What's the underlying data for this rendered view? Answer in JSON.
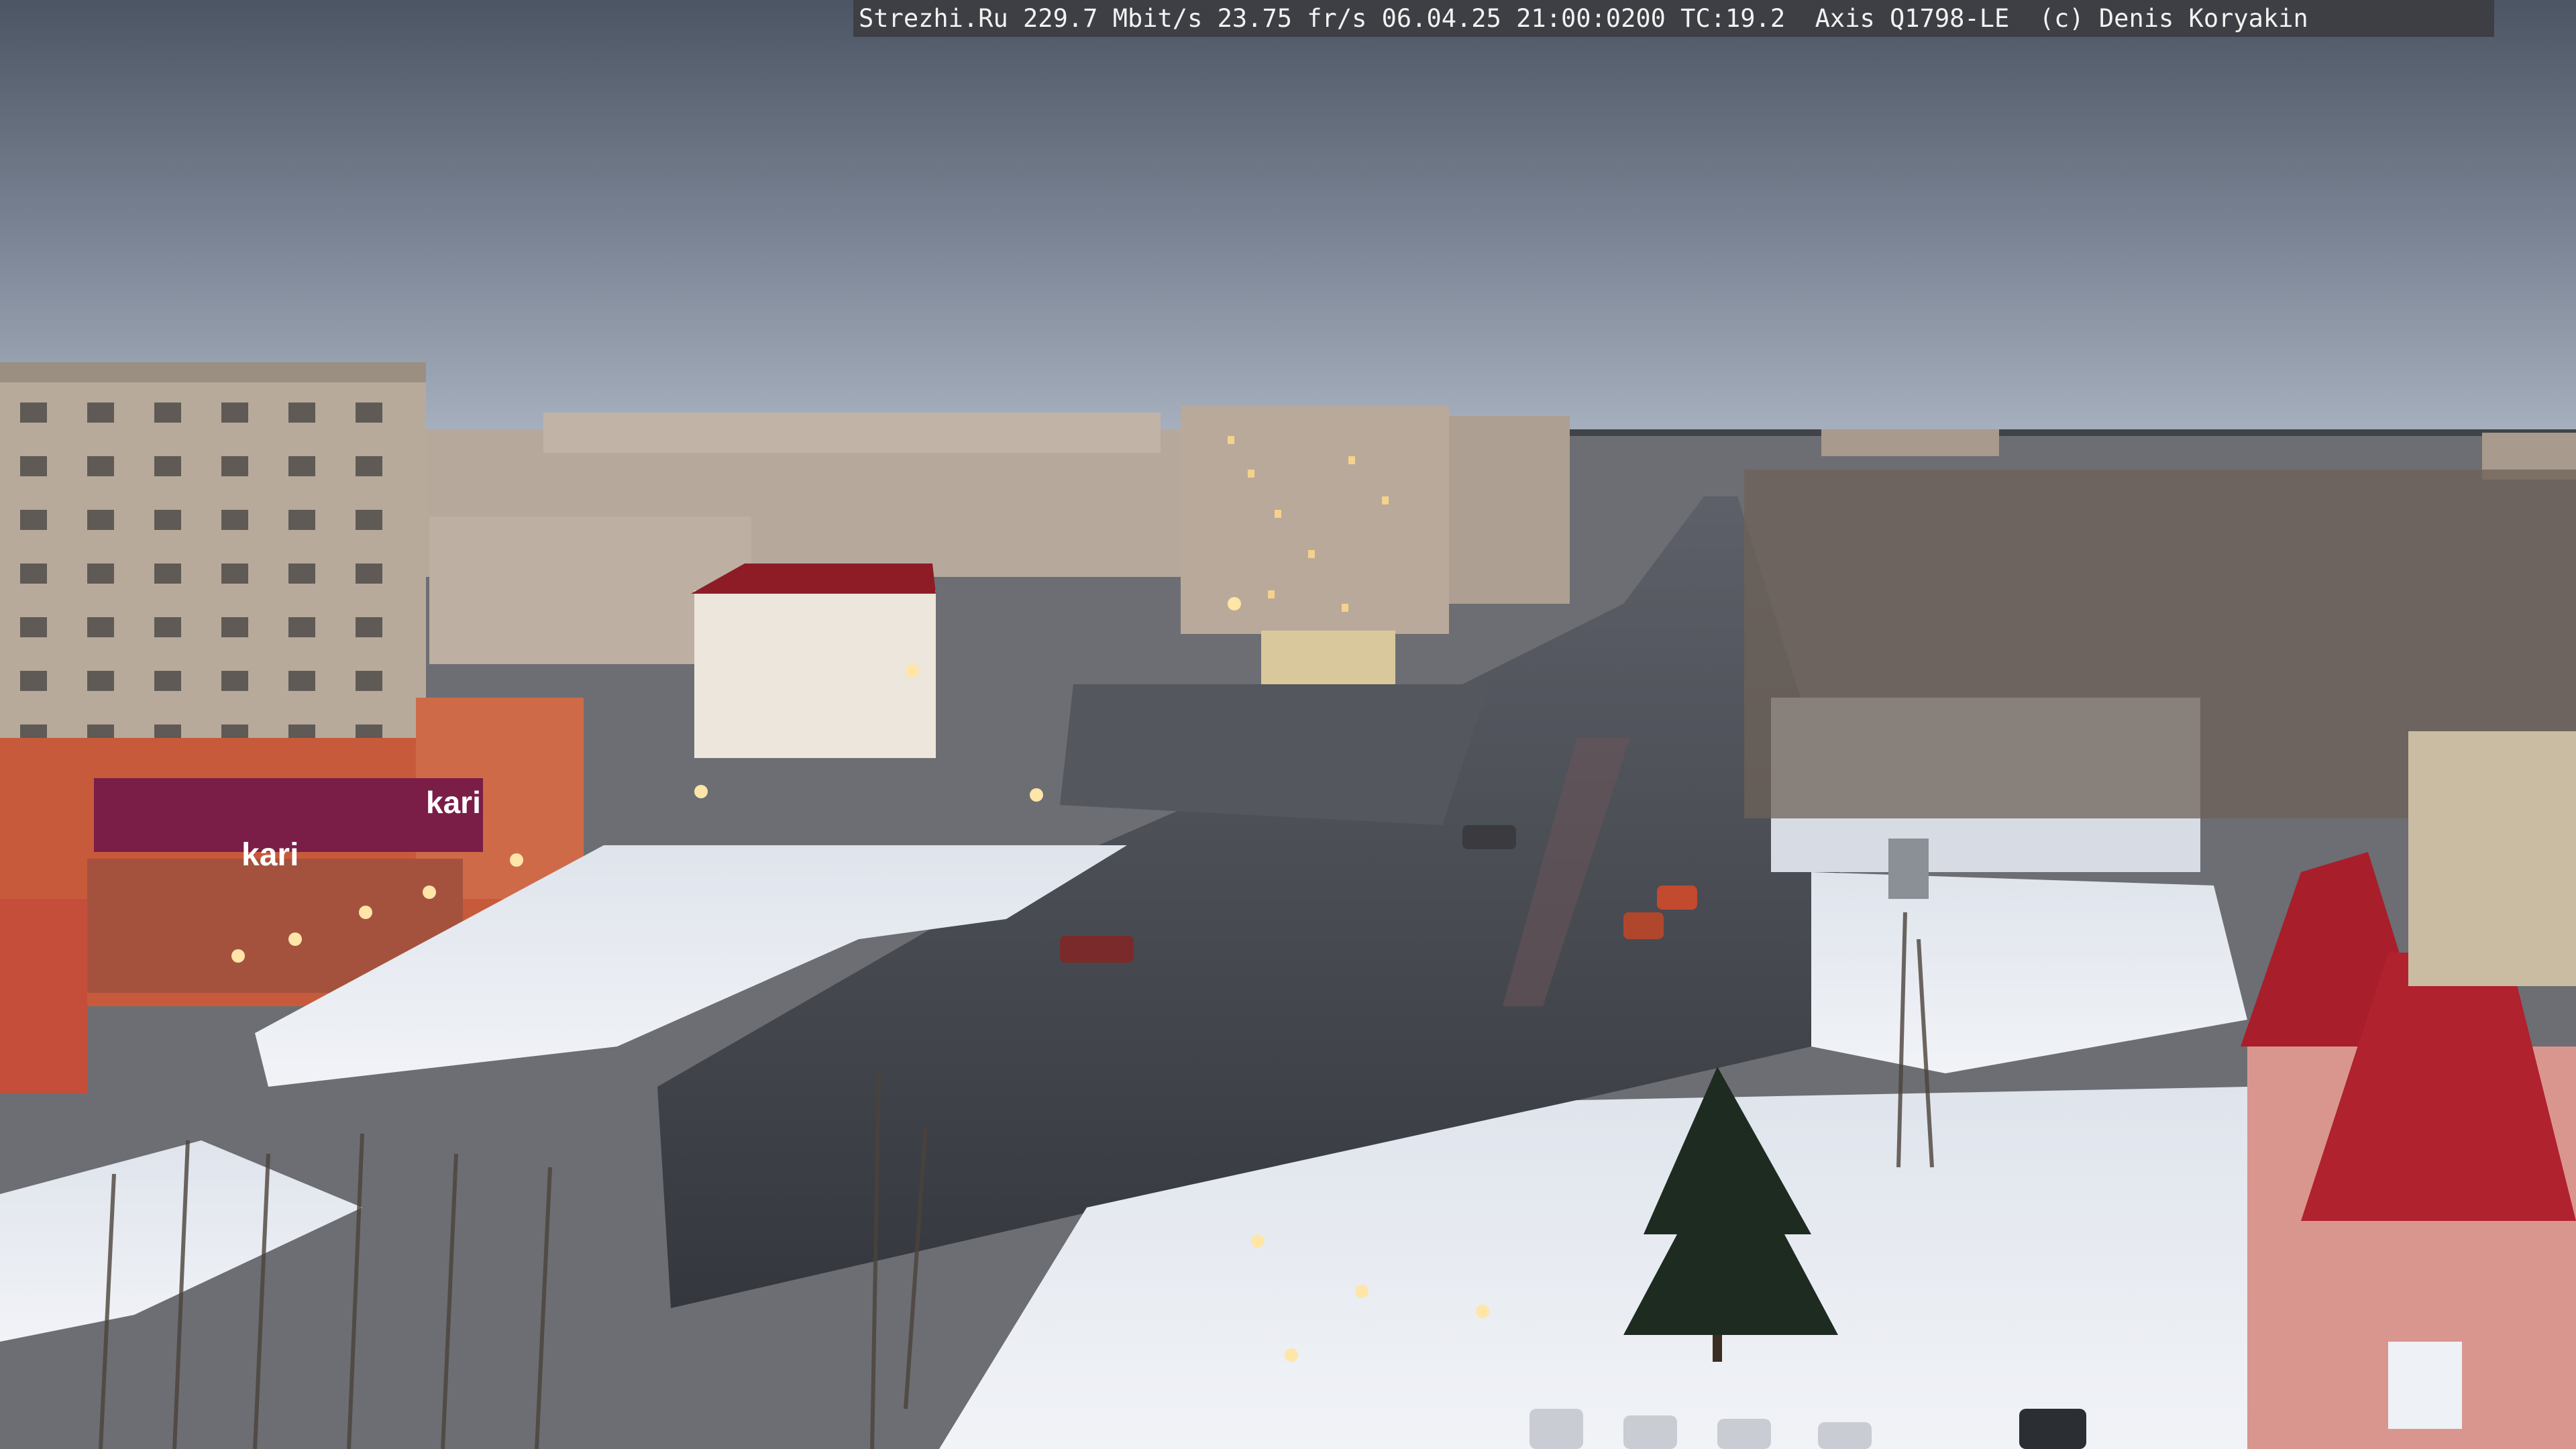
{
  "overlay": {
    "text": "Strezhi.Ru 229.7 Mbit/s 23.75 fr/s 06.04.25 21:00:0200 TC:19.2  Axis Q1798-LE  (c) Denis Koryakin"
  },
  "signs": {
    "kari_store": "kari",
    "kari_store_upper": "kari"
  },
  "colors": {
    "sky_top": "#4e5866",
    "sky_horizon": "#a9b3c1",
    "snow": "#e9edf3",
    "road": "#3b3e44",
    "roof_red": "#a81e2a"
  }
}
